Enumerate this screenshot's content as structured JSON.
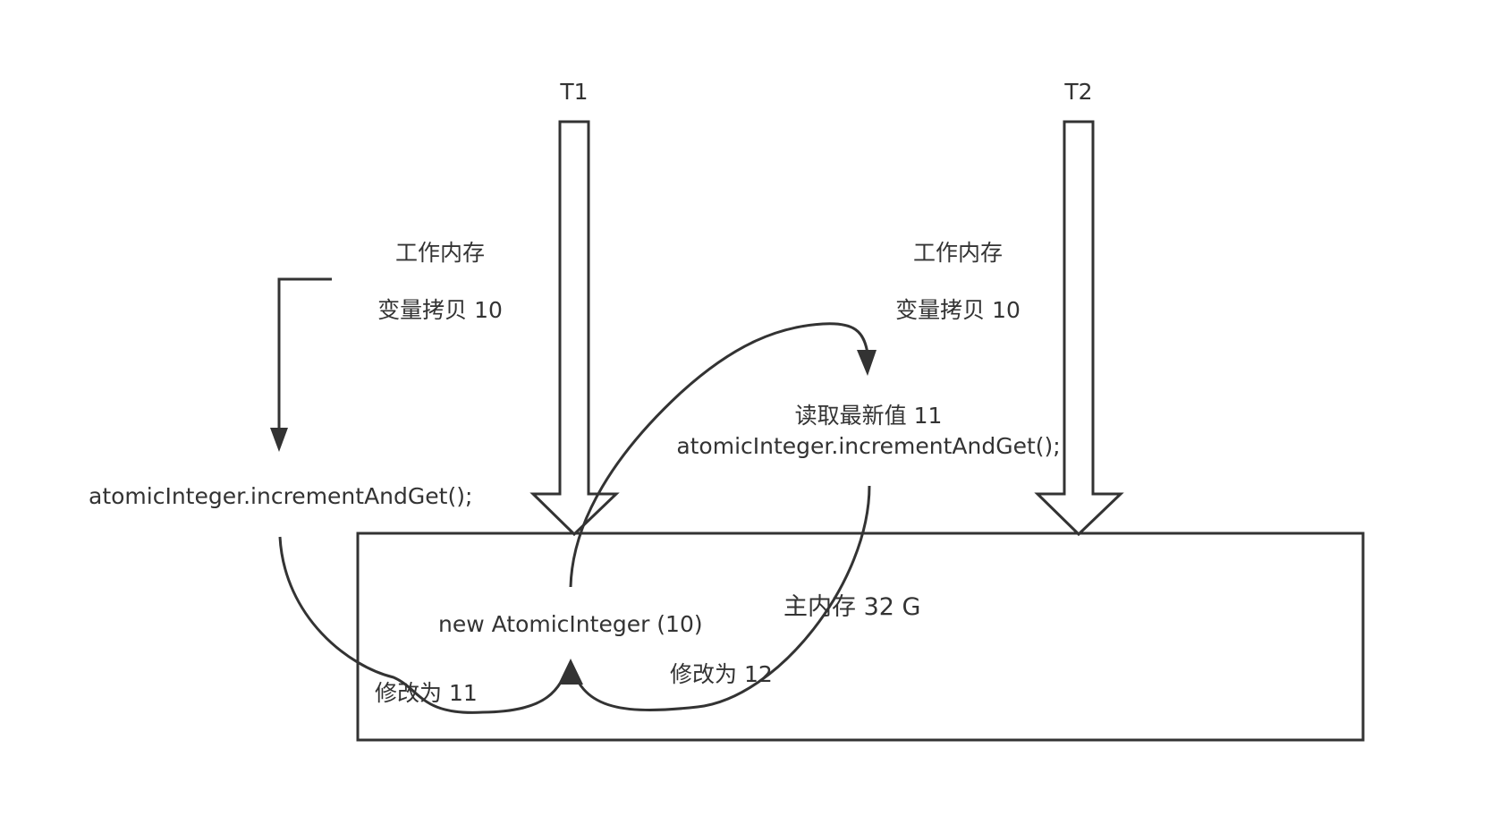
{
  "threads": {
    "t1": "T1",
    "t2": "T2"
  },
  "t1_working": {
    "title": "工作内存",
    "copy": "变量拷贝 10"
  },
  "t2_working": {
    "title": "工作内存",
    "copy": "变量拷贝 10"
  },
  "left_call": "atomicInteger.incrementAndGet();",
  "t2_read": {
    "line1": "读取最新值 11",
    "line2": "atomicInteger.incrementAndGet();"
  },
  "main_memory": {
    "title": "主内存 32 G",
    "object": "new AtomicInteger (10)",
    "modify_11": "修改为 11",
    "modify_12": "修改为 12"
  },
  "colors": {
    "stroke": "#333333",
    "background": "#ffffff"
  }
}
